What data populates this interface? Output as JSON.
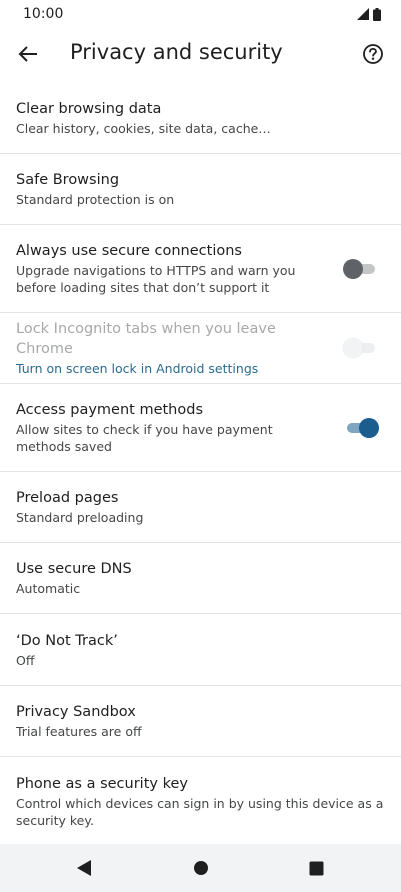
{
  "status": {
    "time": "10:00",
    "icons": [
      "signal-icon",
      "battery-icon"
    ]
  },
  "header": {
    "title": "Privacy and security",
    "back_icon": "arrow-back-icon",
    "help_icon": "help-circle-icon"
  },
  "items": [
    {
      "title": "Clear browsing data",
      "subtitle": "Clear history, cookies, site data, cache…"
    },
    {
      "title": "Safe Browsing",
      "subtitle": "Standard protection is on"
    },
    {
      "title": "Always use secure connections",
      "subtitle": "Upgrade navigations to HTTPS and warn you before loading sites that don’t support it",
      "toggle": "off"
    },
    {
      "title": "Lock Incognito tabs when you leave Chrome",
      "subtitle": "Turn on screen lock in Android settings",
      "toggle": "disabled"
    },
    {
      "title": "Access payment methods",
      "subtitle": "Allow sites to check if you have payment methods saved",
      "toggle": "on"
    },
    {
      "title": "Preload pages",
      "subtitle": "Standard preloading"
    },
    {
      "title": "Use secure DNS",
      "subtitle": "Automatic"
    },
    {
      "title": "‘Do Not Track’",
      "subtitle": "Off"
    },
    {
      "title": "Privacy Sandbox",
      "subtitle": "Trial features are off"
    },
    {
      "title": "Phone as a security key",
      "subtitle": "Control which devices can sign in by using this device as a security key."
    }
  ],
  "nav": {
    "back_icon": "nav-back-triangle-icon",
    "home_icon": "nav-home-circle-icon",
    "recents_icon": "nav-recents-square-icon"
  },
  "colors": {
    "accent": "#1a5d8e",
    "link": "#2c6a8f",
    "divider": "#e3e3e3"
  }
}
